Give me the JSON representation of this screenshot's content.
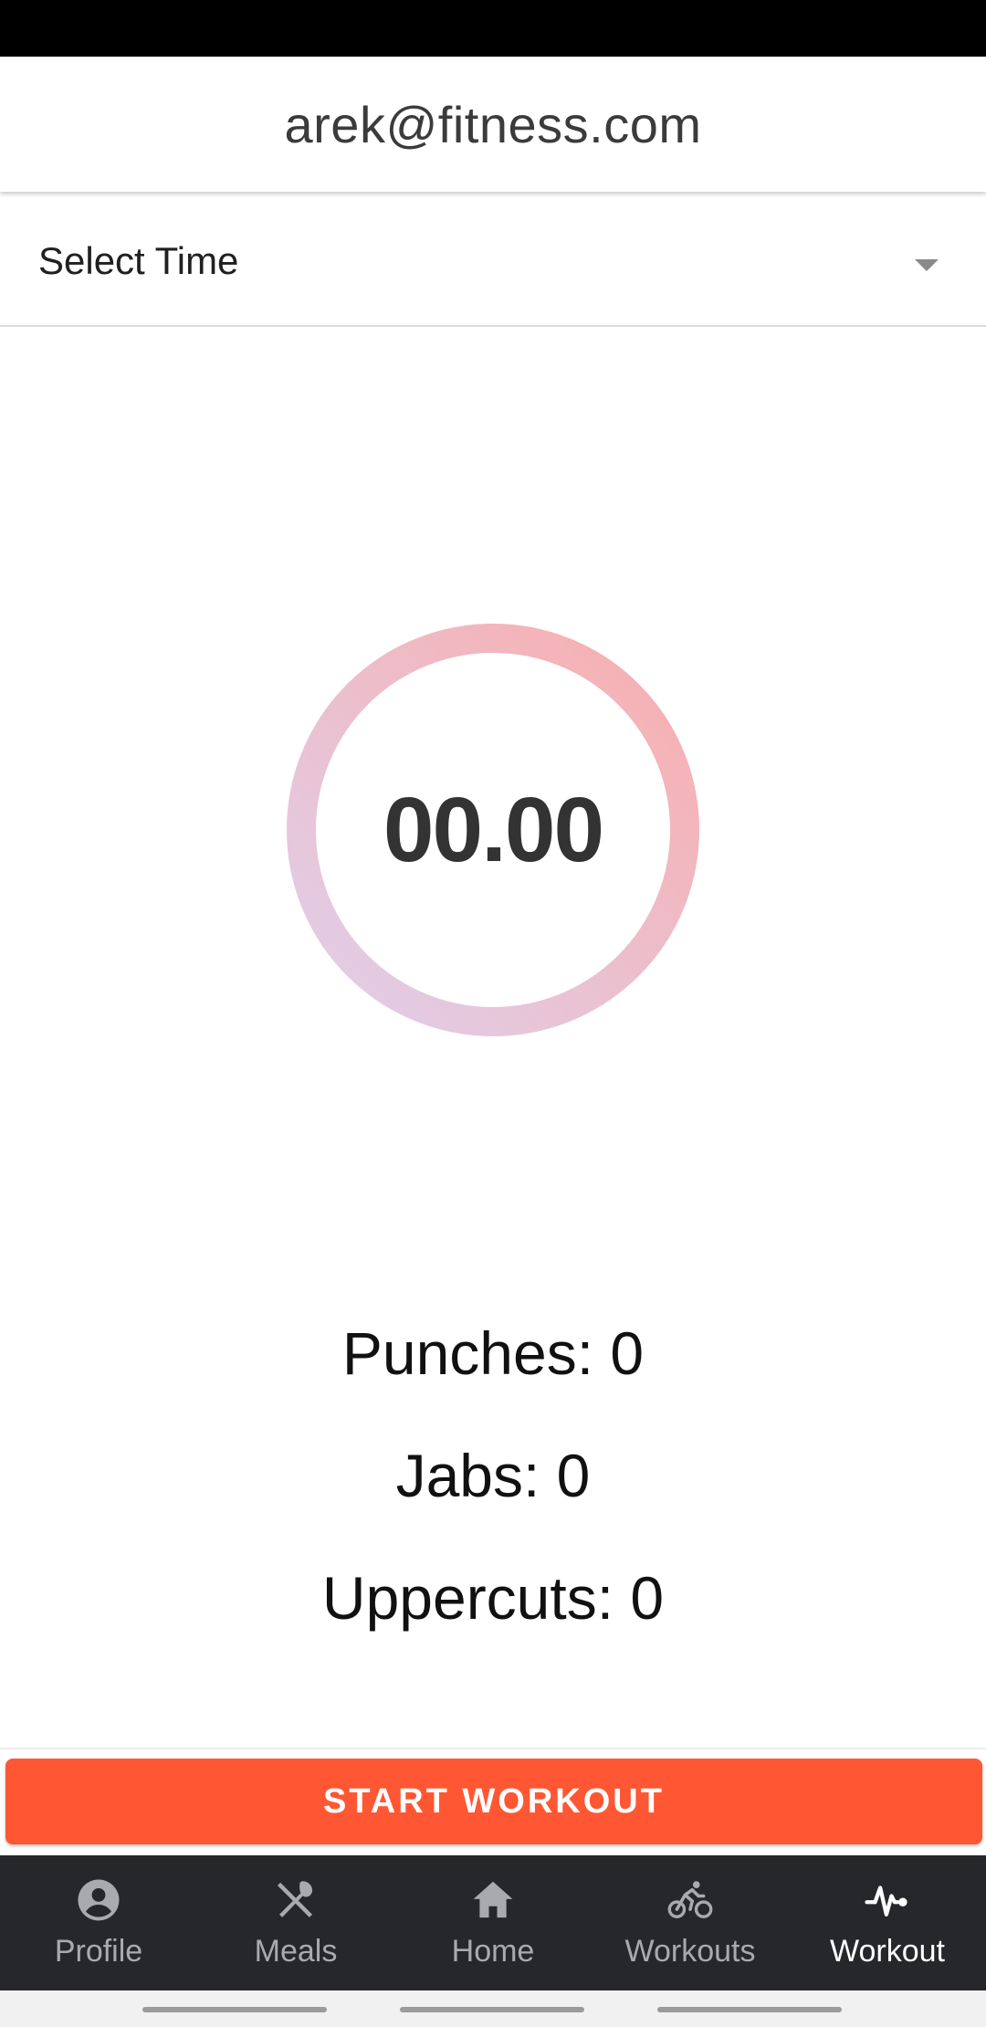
{
  "header": {
    "title": "arek@fitness.com"
  },
  "time_select": {
    "label": "Select Time"
  },
  "timer": {
    "value": "00.00"
  },
  "stats": {
    "punches": "Punches: 0",
    "jabs": "Jabs: 0",
    "uppercuts": "Uppercuts: 0"
  },
  "actions": {
    "start_label": "START WORKOUT"
  },
  "nav": {
    "items": [
      {
        "label": "Profile",
        "icon": "profile-icon"
      },
      {
        "label": "Meals",
        "icon": "meals-icon"
      },
      {
        "label": "Home",
        "icon": "home-icon"
      },
      {
        "label": "Workouts",
        "icon": "bike-icon"
      },
      {
        "label": "Workout",
        "icon": "pulse-icon",
        "active": true
      }
    ]
  },
  "colors": {
    "accent": "#ff5733",
    "nav_background": "#26272b",
    "ring_start": "#f7b0b0",
    "ring_end": "#e2cbe6"
  }
}
